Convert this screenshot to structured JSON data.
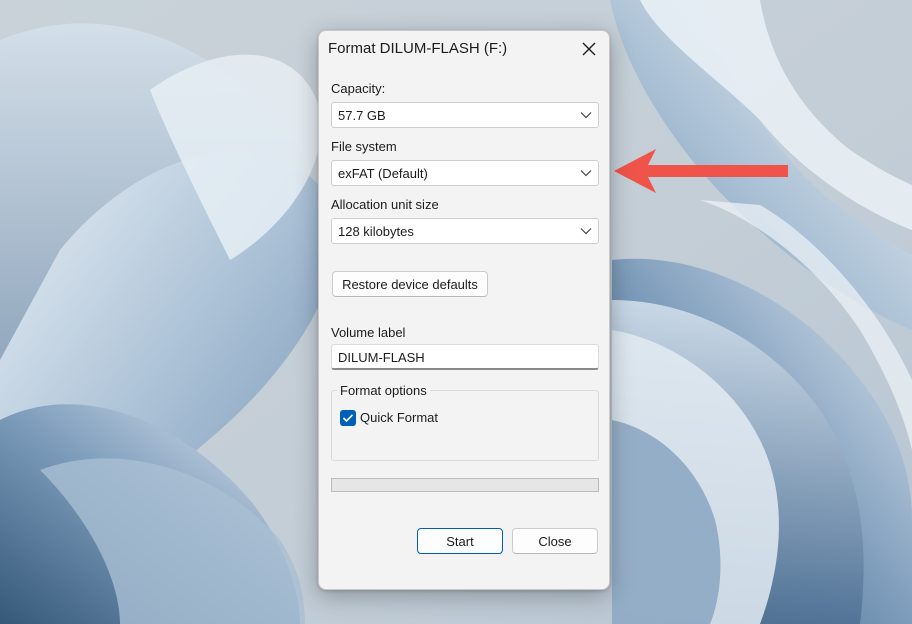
{
  "dialog": {
    "title": "Format DILUM-FLASH (F:)",
    "capacity": {
      "label": "Capacity:",
      "value": "57.7 GB"
    },
    "file_system": {
      "label": "File system",
      "value": "exFAT (Default)"
    },
    "allocation_unit": {
      "label": "Allocation unit size",
      "value": "128 kilobytes"
    },
    "restore_defaults_label": "Restore device defaults",
    "volume_label": {
      "label": "Volume label",
      "value": "DILUM-FLASH"
    },
    "format_options": {
      "title": "Format options",
      "quick_format_label": "Quick Format",
      "quick_format_checked": true
    },
    "progress_fraction": 0,
    "start_label": "Start",
    "close_label": "Close"
  },
  "icons": {
    "close": "close-icon",
    "dropdown": "chevron-down-icon",
    "check": "check-icon",
    "annotation": "red-arrow-annotation"
  },
  "colors": {
    "accent": "#005fb8",
    "annotation_arrow": "#f0534a",
    "dialog_bg": "#f3f3f3"
  }
}
